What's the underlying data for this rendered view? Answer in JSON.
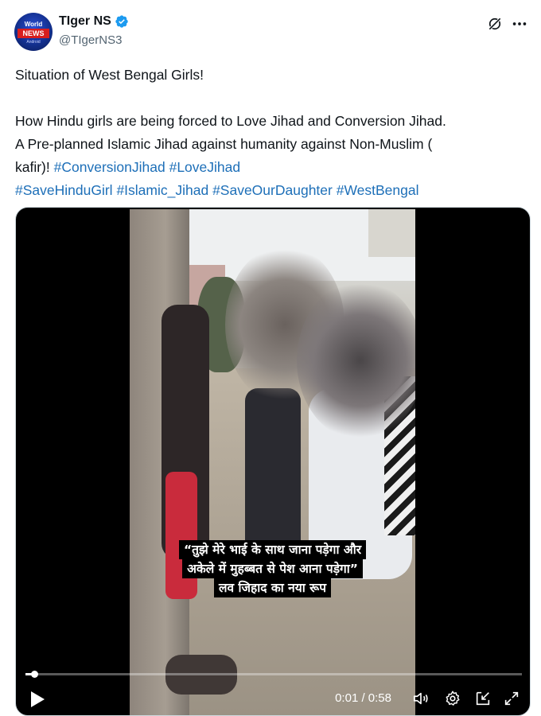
{
  "author": {
    "display_name": "TIger NS",
    "handle": "@TIgerNS3",
    "avatar_text": {
      "top": "World",
      "middle": "NEWS",
      "bottom": "Android"
    },
    "verified": true,
    "verified_color": "#1d9bf0"
  },
  "header_icons": {
    "grok": "grok-icon",
    "more": "more-dots-icon"
  },
  "tweet": {
    "line1": "Situation of West Bengal Girls!",
    "line2": "How Hindu girls are being forced to Love Jihad and Conversion Jihad.",
    "line3": "A Pre-planned Islamic Jihad against humanity against Non-Muslim (",
    "line4_prefix": "kafir)! ",
    "hashtags_line4": [
      "#ConversionJihad",
      "#LoveJihad"
    ],
    "hashtags_line5": [
      "#SaveHinduGirl",
      "#Islamic_Jihad",
      "#SaveOurDaughter",
      "#WestBengal"
    ],
    "hashtag_color": "#1d6fb8"
  },
  "video": {
    "caption_lines": [
      "“तुझे मेरे भाई के साथ जाना पड़ेगा और",
      "अकेले में मुहब्बत से पेश आना पड़ेगा”",
      "लव जिहाद का नया रूप"
    ],
    "time_display": "0:01 / 0:58",
    "progress_fraction": 0.017,
    "controls": [
      "play-icon",
      "volume-icon",
      "settings-gear-icon",
      "pip-icon",
      "fullscreen-icon"
    ]
  }
}
